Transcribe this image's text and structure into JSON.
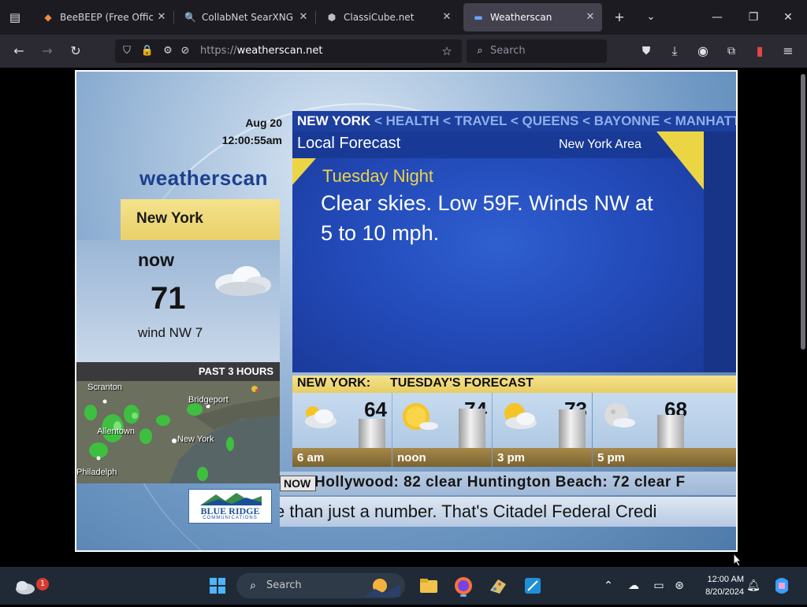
{
  "browser": {
    "menu_icon": "tab-list-icon",
    "tabs": [
      {
        "title": "BeeBEEP (Free Office M",
        "icon": "beebeep-favicon",
        "active": false
      },
      {
        "title": "CollabNet SearXNG",
        "icon": "search-favicon",
        "active": false
      },
      {
        "title": "ClassiCube.net",
        "icon": "cube-favicon",
        "active": false
      },
      {
        "title": "Weatherscan",
        "icon": "weatherscan-favicon",
        "active": true
      }
    ],
    "url_scheme": "https://",
    "url_host": "weatherscan.net",
    "search_placeholder": "Search"
  },
  "weatherscan": {
    "date": "Aug 20",
    "time": "12:00:55am",
    "brand": "weatherscan",
    "location": "New York",
    "current": {
      "label": "now",
      "temperature": "71",
      "wind": "wind NW 7",
      "condition_icon": "cloudy-icon"
    },
    "radar": {
      "header": "PAST 3 HOURS",
      "cities": [
        "Scranton",
        "Bridgeport",
        "New York",
        "Allentown",
        "Philadelphia"
      ]
    },
    "sponsor": {
      "name": "BLUE RIDGE",
      "sub": "COMMUNICATIONS"
    },
    "topics": {
      "current": "NEW YORK",
      "others": [
        "HEALTH",
        "TRAVEL",
        "QUEENS",
        "BAYONNE",
        "MANHATTAN"
      ],
      "separator": "<"
    },
    "local_forecast": {
      "title": "Local Forecast",
      "area": "New York Area",
      "period": "Tuesday Night",
      "text": "Clear skies. Low 59F. Winds NW at 5 to 10 mph."
    },
    "daypart": {
      "location": "NEW YORK:",
      "title": "TUESDAY'S FORECAST",
      "items": [
        {
          "time": "6 am",
          "temp": "64",
          "temp_value": 64,
          "icon": "partly-cloudy-icon"
        },
        {
          "time": "noon",
          "temp": "74",
          "temp_value": 74,
          "icon": "mostly-sunny-icon"
        },
        {
          "time": "3 pm",
          "temp": "73",
          "temp_value": 73,
          "icon": "partly-cloudy-icon"
        },
        {
          "time": "5 pm",
          "temp": "68",
          "temp_value": 68,
          "icon": "moon-cloud-icon"
        }
      ]
    },
    "now_tag": "NOW",
    "now_text": "Hollywood: 82 clear   Huntington Beach: 72 clear   F",
    "crawl": "e than just a number. That's Citadel Federal Credi"
  },
  "taskbar": {
    "weather_badge": "1",
    "search_placeholder": "Search",
    "time": "12:00 AM",
    "date": "8/20/2024"
  }
}
